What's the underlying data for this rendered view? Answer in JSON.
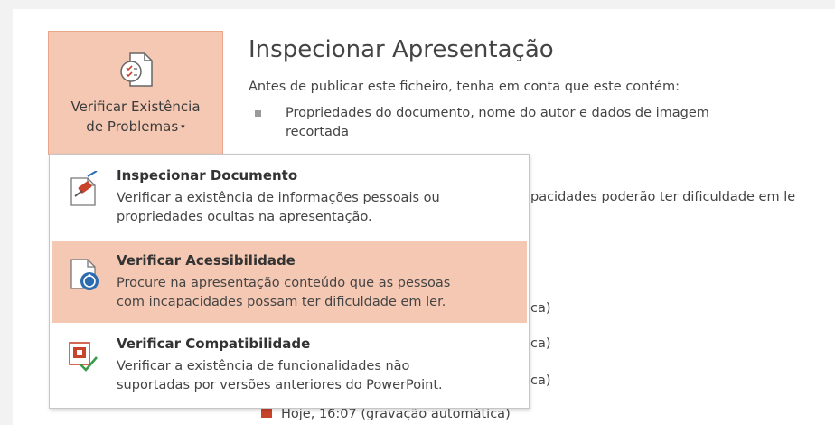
{
  "check_button": {
    "icon": "checklist-document-icon",
    "label_line1": "Verificar Existência",
    "label_line2": "de Problemas",
    "caret": "▾"
  },
  "inspect_section": {
    "title": "Inspecionar Apresentação",
    "intro": "Antes de publicar este ficheiro, tenha em conta que este contém:",
    "bullet_line1": "Propriedades do documento, nome do autor e dados de imagem",
    "bullet_line2": "recortada",
    "partial_accessibility": "pacidades poderão ter dificuldade em le",
    "partial_versions": [
      "ca)",
      "ca)",
      "ca)"
    ],
    "recent_version": "Hoje, 16:07 (gravação automática)"
  },
  "menu": {
    "items": [
      {
        "icon": "inspect-document-icon",
        "title": "Inspecionar Documento",
        "desc_line1": "Verificar a existência de informações pessoais ou",
        "desc_line2": "propriedades ocultas na apresentação."
      },
      {
        "icon": "accessibility-check-icon",
        "title": "Verificar Acessibilidade",
        "desc_line1": "Procure na apresentação conteúdo que as pessoas",
        "desc_line2": "com incapacidades possam ter dificuldade em ler."
      },
      {
        "icon": "compatibility-check-icon",
        "title": "Verificar Compatibilidade",
        "desc_line1": "Verificar a existência de funcionalidades não",
        "desc_line2": "suportadas por versões anteriores do PowerPoint."
      }
    ]
  },
  "colors": {
    "highlight": "#f5c8b3",
    "highlight_border": "#e8a78a",
    "accent_red": "#c8432b"
  }
}
